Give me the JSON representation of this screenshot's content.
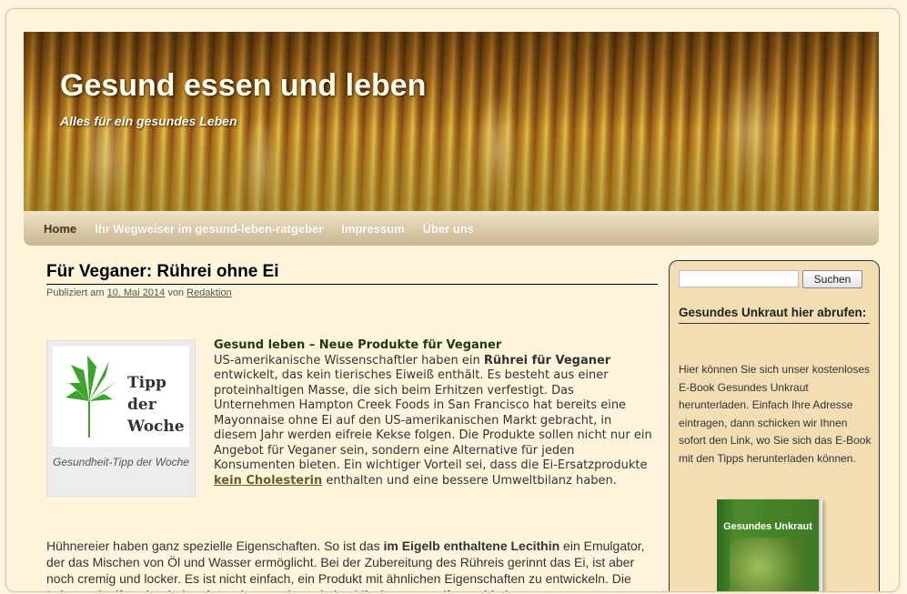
{
  "site": {
    "title": "Gesund essen und leben",
    "description": "Alles für ein gesundes Leben"
  },
  "nav": {
    "items": [
      {
        "label": "Home"
      },
      {
        "label": "Ihr Wegweiser im gesund-leben-ratgeber"
      },
      {
        "label": "Impressum"
      },
      {
        "label": "Über uns"
      }
    ]
  },
  "post": {
    "title": "Für Veganer: Rührei ohne Ei",
    "meta_prefix": "Publiziert am",
    "date": "10. Mai 2014",
    "meta_by": "von",
    "author": "Redaktion",
    "tip_image_text": "Tipp der Woche",
    "tip_caption": "Gesundheit-Tipp der Woche",
    "lead": "Gesund leben – Neue Produkte für Veganer",
    "p1_before_bold": "US-amerikanische Wissenschaftler haben ein ",
    "p1_bold": "Rührei für Veganer",
    "p1_after_bold": " entwickelt, das kein tierisches Eiweiß enthält. Es besteht aus einer proteinhaltigen Masse, die sich beim Erhitzen verfestigt. Das Unternehmen Hampton Creek Foods in San Francisco hat bereits eine Mayonnaise ohne Ei auf den US-amerikanischen Markt gebracht, in diesem Jahr werden eifreie Kekse folgen. Die Produkte sollen nicht nur ein Angebot für Veganer sein, sondern eine Alternative für jeden Konsumenten bieten. Ein wichtiger Vorteil sei, dass die Ei-Ersatzprodukte ",
    "p1_link": "kein Cholesterin",
    "p1_end": " enthalten und eine bessere Umweltbilanz haben.",
    "p2_before_bold": "Hühnereier haben ganz spezielle Eigenschaften. So ist das ",
    "p2_bold": "im Eigelb enthaltene Lecithin",
    "p2_after_bold": " ein Emulgator, der das Mischen von Öl und Wasser ermöglicht. Bei der Zubereitung des Rühreis gerinnt das Ei, ist aber noch cremig und locker. Es ist nicht einfach, ein Produkt mit ähnlichen Eigenschaften zu entwickeln. Die Lebensmittelforscher haben intensiv gesucht und eine Mischung aus elf verschiedenen"
  },
  "sidebar": {
    "search_value": "",
    "search_button": "Suchen",
    "widget_title": "Gesundes Unkraut hier abrufen:",
    "widget_text": "Hier können Sie sich unser kostenloses E-Book Gesundes Unkraut herunterladen. Einfach Ihre Adresse eintragen, dann schicken wir Ihnen sofort den Link, wo Sie sich das E-Book mit den Tipps herunterladen können.",
    "ebook_title": "Gesundes Unkraut"
  },
  "colors": {
    "background": "#fff5dd",
    "nav_gradient_top": "#efe3c6",
    "nav_gradient_bottom": "#c9b690",
    "sidebar_bg": "#f3ddb4",
    "lead_text": "#1f3a12",
    "link_brown": "#6b5a2a"
  }
}
